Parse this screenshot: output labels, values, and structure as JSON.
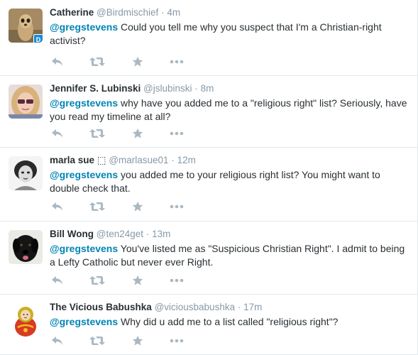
{
  "tweets": [
    {
      "fullname": "Catherine",
      "username": "@Birdmischief",
      "separator": "·",
      "time": "4m",
      "mention": "@gregstevens",
      "text": " Could you tell me why you suspect that I'm a Christian-right activist?",
      "avatar": "meerkat-avatar"
    },
    {
      "fullname": "Jennifer S. Lubinski",
      "username": "@jslubinski",
      "separator": "·",
      "time": "8m",
      "mention": "@gregstevens",
      "text": " why have you added me to a \"religious right\" list? Seriously, have you read my timeline at all?",
      "avatar": "woman-sunglasses-avatar"
    },
    {
      "fullname": "marla sue ⬚",
      "username": "@marlasue01",
      "separator": "·",
      "time": "12m",
      "mention": "@gregstevens",
      "text": " you added me to your religious right list? You might want to double check that.",
      "avatar": "vintage-portrait-avatar"
    },
    {
      "fullname": "Bill Wong",
      "username": "@ten24get",
      "separator": "·",
      "time": "13m",
      "mention": "@gregstevens",
      "text": " You've listed me as \"Suspicious Christian Right\". I admit to being a Lefty Catholic but never ever Right.",
      "avatar": "black-dog-avatar"
    },
    {
      "fullname": "The Vicious Babushka",
      "username": "@viciousbabushka",
      "separator": "·",
      "time": "17m",
      "mention": "@gregstevens",
      "text": " Why did u add me to a list called \"religious right\"?",
      "avatar": "matryoshka-avatar"
    }
  ],
  "colors": {
    "link": "#0084b4",
    "muted": "#8899a6",
    "icon": "#aab8c2",
    "divider": "#e1e8ed"
  },
  "action_icons": [
    "reply-icon",
    "retweet-icon",
    "favorite-icon",
    "more-icon"
  ]
}
